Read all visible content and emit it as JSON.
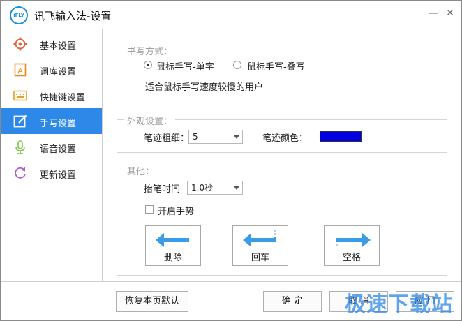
{
  "window": {
    "logo_text": "iFLY",
    "title": "讯飞输入法-设置",
    "minimize_glyph": "—",
    "close_glyph": "✕"
  },
  "sidebar": {
    "items": [
      {
        "label": "基本设置",
        "icon": "gear-icon",
        "active": false
      },
      {
        "label": "词库设置",
        "icon": "dictionary-icon",
        "active": false
      },
      {
        "label": "快捷键设置",
        "icon": "keyboard-icon",
        "active": false
      },
      {
        "label": "手写设置",
        "icon": "pen-edit-icon",
        "active": true
      },
      {
        "label": "语音设置",
        "icon": "microphone-icon",
        "active": false
      },
      {
        "label": "更新设置",
        "icon": "refresh-icon",
        "active": false
      }
    ]
  },
  "writing_mode": {
    "legend": "书写方式：",
    "option_single": "鼠标手写-单字",
    "option_overlap": "鼠标手写-叠写",
    "selected": "鼠标手写-单字",
    "description": "适合鼠标手写速度较慢的用户"
  },
  "appearance": {
    "legend": "外观设置：",
    "stroke_width_label": "笔迹粗细：",
    "stroke_width_value": "5",
    "stroke_color_label": "笔迹颜色：",
    "stroke_color": "#0000e0"
  },
  "other": {
    "legend": "其他：",
    "lift_time_label": "抬笔时间",
    "lift_time_value": "1.0秒",
    "gesture_label": "开启手势",
    "gesture_checked": false,
    "gestures": [
      {
        "label": "删除",
        "icon": "left-arrow-icon"
      },
      {
        "label": "回车",
        "icon": "enter-arrow-icon"
      },
      {
        "label": "空格",
        "icon": "right-arrow-icon"
      }
    ]
  },
  "footer": {
    "restore_label": "恢复本页默认",
    "ok_label": "确 定",
    "cancel_label": "取 消",
    "apply_label": "应 用"
  },
  "watermark": "极速下载站"
}
